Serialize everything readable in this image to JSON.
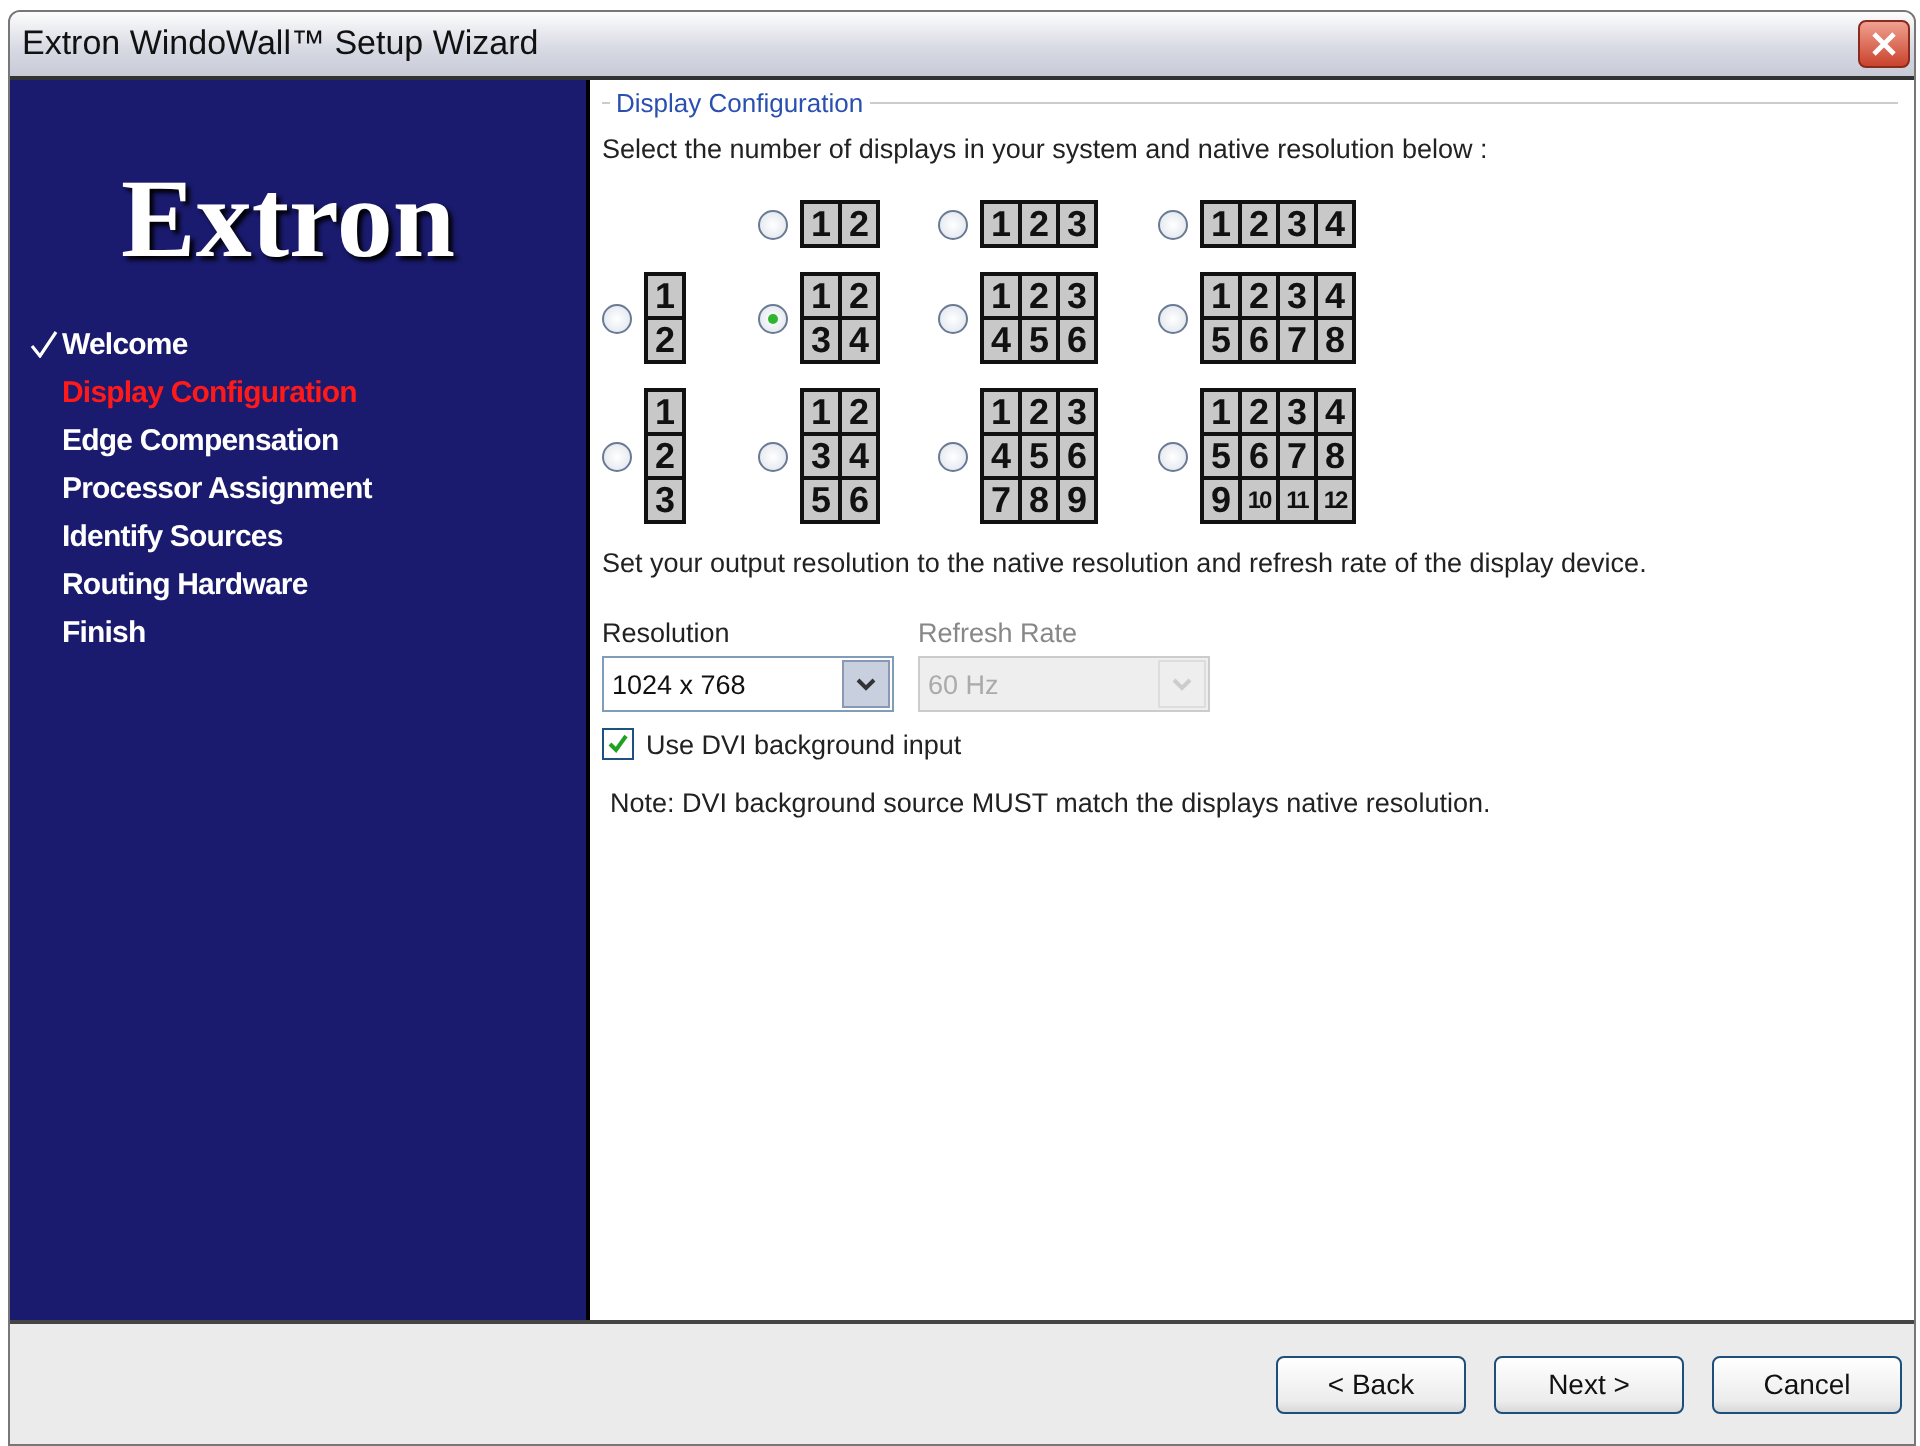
{
  "window": {
    "title": "Extron WindoWall™ Setup Wizard"
  },
  "sidebar": {
    "logo": "Extron",
    "steps": [
      {
        "label": "Welcome",
        "completed": true,
        "selected": false
      },
      {
        "label": "Display Configuration",
        "completed": false,
        "selected": true
      },
      {
        "label": "Edge Compensation",
        "completed": false,
        "selected": false
      },
      {
        "label": "Processor Assignment",
        "completed": false,
        "selected": false
      },
      {
        "label": "Identify Sources",
        "completed": false,
        "selected": false
      },
      {
        "label": "Routing Hardware",
        "completed": false,
        "selected": false
      },
      {
        "label": "Finish",
        "completed": false,
        "selected": false
      }
    ]
  },
  "group": {
    "title": "Display Configuration",
    "instruction": "Select the number of displays in your system and native resolution below :",
    "layout_rows": [
      [
        {
          "selected": false,
          "cells": [
            [
              "1",
              "2"
            ]
          ]
        },
        {
          "selected": false,
          "cells": [
            [
              "1",
              "2",
              "3"
            ]
          ]
        },
        {
          "selected": false,
          "cells": [
            [
              "1",
              "2",
              "3",
              "4"
            ]
          ]
        }
      ],
      [
        {
          "selected": false,
          "cells": [
            [
              "1"
            ],
            [
              "2"
            ]
          ]
        },
        {
          "selected": true,
          "cells": [
            [
              "1",
              "2"
            ],
            [
              "3",
              "4"
            ]
          ]
        },
        {
          "selected": false,
          "cells": [
            [
              "1",
              "2",
              "3"
            ],
            [
              "4",
              "5",
              "6"
            ]
          ]
        },
        {
          "selected": false,
          "cells": [
            [
              "1",
              "2",
              "3",
              "4"
            ],
            [
              "5",
              "6",
              "7",
              "8"
            ]
          ]
        }
      ],
      [
        {
          "selected": false,
          "cells": [
            [
              "1"
            ],
            [
              "2"
            ],
            [
              "3"
            ]
          ]
        },
        {
          "selected": false,
          "cells": [
            [
              "1",
              "2"
            ],
            [
              "3",
              "4"
            ],
            [
              "5",
              "6"
            ]
          ]
        },
        {
          "selected": false,
          "cells": [
            [
              "1",
              "2",
              "3"
            ],
            [
              "4",
              "5",
              "6"
            ],
            [
              "7",
              "8",
              "9"
            ]
          ]
        },
        {
          "selected": false,
          "cells": [
            [
              "1",
              "2",
              "3",
              "4"
            ],
            [
              "5",
              "6",
              "7",
              "8"
            ],
            [
              "9",
              "10",
              "11",
              "12"
            ]
          ]
        }
      ]
    ],
    "output_note": "Set your output resolution to the native resolution and refresh rate of the display device.",
    "resolution": {
      "label": "Resolution",
      "value": "1024 x 768",
      "disabled": false
    },
    "refresh_rate": {
      "label": "Refresh Rate",
      "value": "60 Hz",
      "disabled": true
    },
    "dvi_checkbox": {
      "label": "Use DVI background input",
      "checked": true
    },
    "note": "Note: DVI background source MUST match the displays native resolution."
  },
  "buttons": [
    {
      "label": "< Back"
    },
    {
      "label": "Next >"
    },
    {
      "label": "Cancel"
    }
  ]
}
